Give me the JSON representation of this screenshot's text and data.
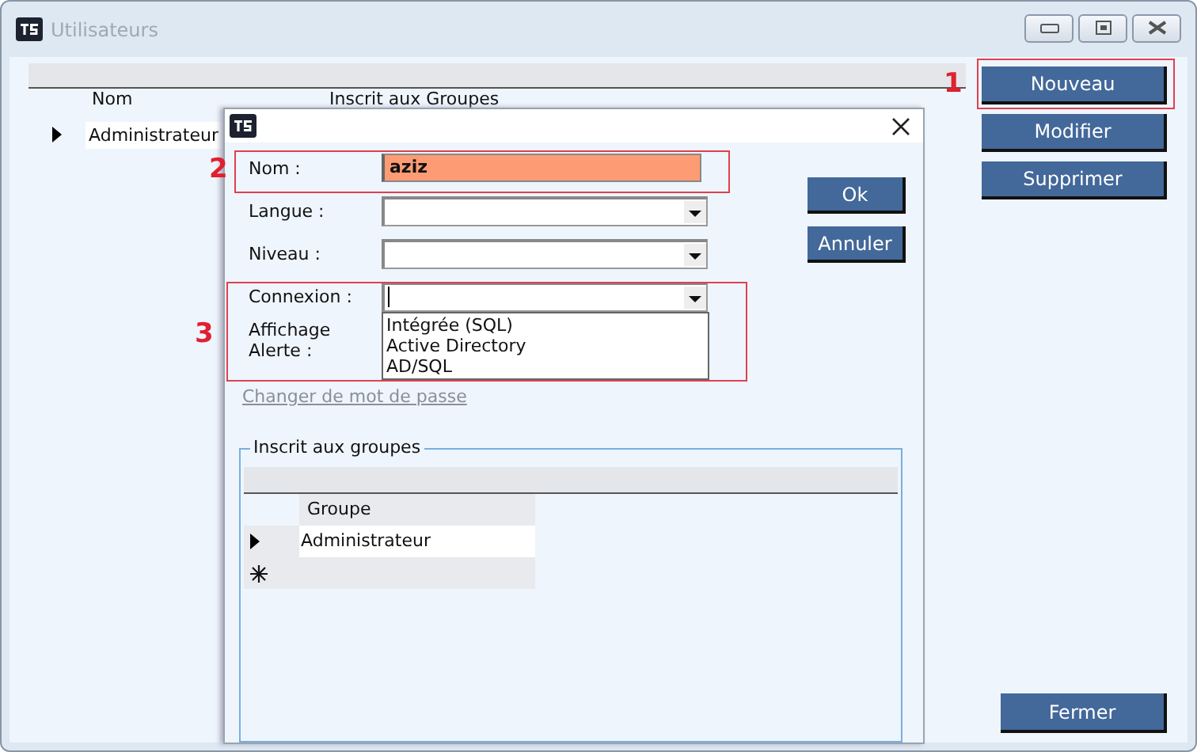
{
  "window": {
    "title": "Utilisateurs"
  },
  "users_table": {
    "columns": [
      "Nom",
      "Inscrit aux Groupes"
    ],
    "rows": [
      {
        "cells": [
          "Administrateur"
        ],
        "current": true
      }
    ]
  },
  "side_buttons": [
    "Nouveau",
    "Modifier",
    "Supprimer"
  ],
  "close_button": "Fermer",
  "dialog": {
    "fields": [
      {
        "label": "Nom :",
        "kind": "text",
        "value": "aziz",
        "highlighted": true
      },
      {
        "label": "Langue :",
        "kind": "combo"
      },
      {
        "label": "Niveau :",
        "kind": "combo"
      },
      {
        "label": "Connexion :",
        "kind": "combo",
        "focused": true,
        "open": true,
        "options": [
          "Intégrée (SQL)",
          "Active Directory",
          "AD/SQL"
        ]
      },
      {
        "label": "Affichage Alerte :",
        "kind": "label"
      }
    ],
    "link": "Changer de mot de passe",
    "buttons": [
      "Ok",
      "Annuler"
    ],
    "groups": {
      "legend": "Inscrit aux groupes",
      "column": "Groupe",
      "rows": [
        {
          "kind": "current",
          "value": "Administrateur"
        },
        {
          "kind": "new"
        }
      ]
    }
  },
  "annotations": [
    "1",
    "2",
    "3"
  ]
}
